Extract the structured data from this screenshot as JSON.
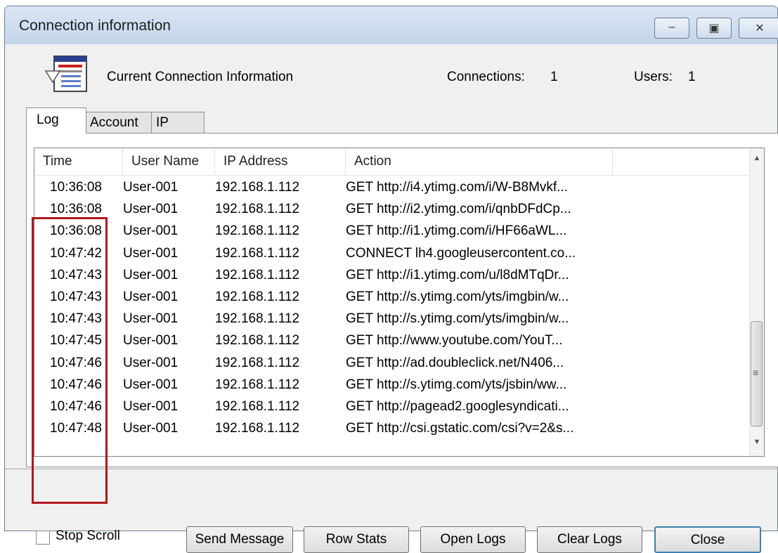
{
  "window": {
    "title": "Connection information",
    "buttons": {
      "minimize": "‒",
      "maximize": "▣",
      "close": "✕"
    }
  },
  "header": {
    "label": "Current Connection Information",
    "connections_label": "Connections:",
    "connections_value": "1",
    "users_label": "Users:",
    "users_value": "1"
  },
  "tabs": [
    {
      "label": "Log",
      "active": true
    },
    {
      "label": "Account",
      "active": false
    },
    {
      "label": "IP",
      "active": false
    }
  ],
  "table": {
    "columns": [
      "Time",
      "User Name",
      "IP Address",
      "Action"
    ],
    "rows": [
      {
        "time": "10:36:08",
        "user": "User-001",
        "ip": "192.168.1.112",
        "action": "GET http://i4.ytimg.com/i/W-B8Mvkf..."
      },
      {
        "time": "10:36:08",
        "user": "User-001",
        "ip": "192.168.1.112",
        "action": "GET http://i2.ytimg.com/i/qnbDFdCp..."
      },
      {
        "time": "10:36:08",
        "user": "User-001",
        "ip": "192.168.1.112",
        "action": "GET http://i1.ytimg.com/i/HF66aWL..."
      },
      {
        "time": "10:47:42",
        "user": "User-001",
        "ip": "192.168.1.112",
        "action": "CONNECT lh4.googleusercontent.co..."
      },
      {
        "time": "10:47:43",
        "user": "User-001",
        "ip": "192.168.1.112",
        "action": "GET http://i1.ytimg.com/u/l8dMTqDr..."
      },
      {
        "time": "10:47:43",
        "user": "User-001",
        "ip": "192.168.1.112",
        "action": "GET http://s.ytimg.com/yts/imgbin/w..."
      },
      {
        "time": "10:47:43",
        "user": "User-001",
        "ip": "192.168.1.112",
        "action": "GET http://s.ytimg.com/yts/imgbin/w..."
      },
      {
        "time": "10:47:45",
        "user": "User-001",
        "ip": "192.168.1.112",
        "action": "GET http://www.youtube.com/YouT..."
      },
      {
        "time": "10:47:46",
        "user": "User-001",
        "ip": "192.168.1.112",
        "action": "GET http://ad.doubleclick.net/N406..."
      },
      {
        "time": "10:47:46",
        "user": "User-001",
        "ip": "192.168.1.112",
        "action": "GET http://s.ytimg.com/yts/jsbin/ww..."
      },
      {
        "time": "10:47:46",
        "user": "User-001",
        "ip": "192.168.1.112",
        "action": "GET http://pagead2.googlesyndicati..."
      },
      {
        "time": "10:47:48",
        "user": "User-001",
        "ip": "192.168.1.112",
        "action": "GET http://csi.gstatic.com/csi?v=2&s..."
      }
    ]
  },
  "footer": {
    "stop_scroll_label": "Stop Scroll",
    "stop_scroll_checked": false,
    "buttons": {
      "send_message": "Send Message",
      "row_stats": "Row Stats",
      "open_logs": "Open Logs",
      "clear_logs": "Clear Logs",
      "close": "Close"
    }
  },
  "colors": {
    "highlight": "#b0161d",
    "titlebar": "#c4d5eb"
  }
}
